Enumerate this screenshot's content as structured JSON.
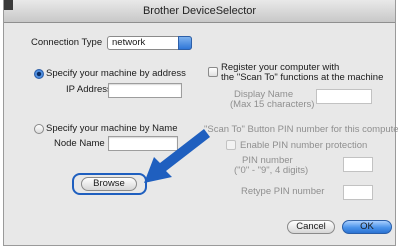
{
  "window": {
    "title": "Brother DeviceSelector"
  },
  "connection": {
    "label": "Connection Type",
    "selected": "network"
  },
  "left": {
    "address_radio": "Specify your machine by address",
    "ip_label": "IP Address",
    "ip_value": "",
    "name_radio": "Specify your machine by Name",
    "node_label": "Node Name",
    "node_value": "",
    "browse": "Browse"
  },
  "right": {
    "register_line1": "Register your computer with",
    "register_line2": "the \"Scan To\" functions at the machine",
    "display_line1": "Display Name",
    "display_line2": "(Max 15 characters)",
    "pin_heading": "\"Scan To\" Button PIN number for this compute",
    "enable_pin": "Enable PIN number protection",
    "pin_line1": "PIN number",
    "pin_line2": "(\"0\" - \"9\", 4 digits)",
    "retype": "Retype PIN number"
  },
  "footer": {
    "cancel": "Cancel",
    "ok": "OK"
  },
  "colors": {
    "arrow": "#1f5fbf",
    "accent": "#2f77d8"
  },
  "icons": {
    "pointer": "arrow-pointer-icon"
  }
}
